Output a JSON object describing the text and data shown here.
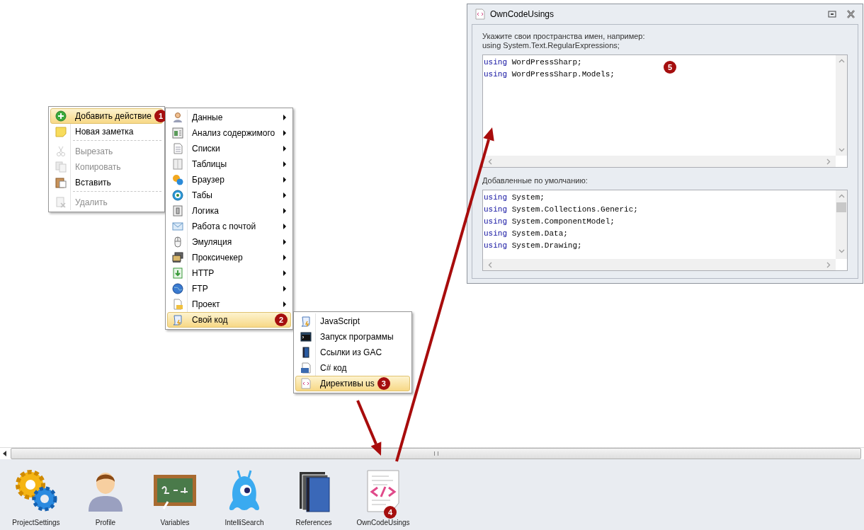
{
  "context_menu": {
    "items": [
      {
        "kind": "item",
        "label": "Добавить действие",
        "selected": true,
        "disabled": false,
        "badge": "1"
      },
      {
        "kind": "item",
        "label": "Новая заметка",
        "selected": false,
        "disabled": false
      },
      {
        "kind": "separator"
      },
      {
        "kind": "item",
        "label": "Вырезать",
        "selected": false,
        "disabled": true
      },
      {
        "kind": "item",
        "label": "Копировать",
        "selected": false,
        "disabled": true
      },
      {
        "kind": "item",
        "label": "Вставить",
        "selected": false,
        "disabled": false
      },
      {
        "kind": "separator"
      },
      {
        "kind": "item",
        "label": "Удалить",
        "selected": false,
        "disabled": true
      }
    ]
  },
  "actions_submenu": {
    "items": [
      {
        "kind": "item",
        "label": "Данные",
        "selected": false,
        "has_submenu": true
      },
      {
        "kind": "item",
        "label": "Анализ содержимого",
        "selected": false,
        "has_submenu": true
      },
      {
        "kind": "item",
        "label": "Списки",
        "selected": false,
        "has_submenu": true
      },
      {
        "kind": "item",
        "label": "Таблицы",
        "selected": false,
        "has_submenu": true
      },
      {
        "kind": "item",
        "label": "Браузер",
        "selected": false,
        "has_submenu": true
      },
      {
        "kind": "item",
        "label": "Табы",
        "selected": false,
        "has_submenu": true
      },
      {
        "kind": "item",
        "label": "Логика",
        "selected": false,
        "has_submenu": true
      },
      {
        "kind": "item",
        "label": "Работа с почтой",
        "selected": false,
        "has_submenu": true
      },
      {
        "kind": "item",
        "label": "Эмуляция",
        "selected": false,
        "has_submenu": true
      },
      {
        "kind": "item",
        "label": "Проксичекер",
        "selected": false,
        "has_submenu": true
      },
      {
        "kind": "item",
        "label": "HTTP",
        "selected": false,
        "has_submenu": true
      },
      {
        "kind": "item",
        "label": "FTP",
        "selected": false,
        "has_submenu": true
      },
      {
        "kind": "item",
        "label": "Проект",
        "selected": false,
        "has_submenu": true
      },
      {
        "kind": "item",
        "label": "Свой код",
        "selected": true,
        "has_submenu": false,
        "badge": "2"
      }
    ]
  },
  "code_submenu": {
    "items": [
      {
        "kind": "item",
        "label": "JavaScript",
        "selected": false
      },
      {
        "kind": "item",
        "label": "Запуск программы",
        "selected": false
      },
      {
        "kind": "item",
        "label": "Ссылки из GAC",
        "selected": false
      },
      {
        "kind": "item",
        "label": "C# код",
        "selected": false
      },
      {
        "kind": "item",
        "label": "Директивы us",
        "selected": true,
        "badge": "3"
      }
    ]
  },
  "window": {
    "title": "OwnCodeUsings",
    "hint_lines": [
      "Укажите свои пространства имен, например:",
      "using System.Text.RegularExpressions;"
    ],
    "custom_usings": [
      {
        "keyword": "using",
        "text": "WordPressSharp;"
      },
      {
        "keyword": "using",
        "text": "WordPressSharp.Models;"
      }
    ],
    "badge": "5",
    "default_label": "Добавленные по умолчанию:",
    "default_usings": [
      {
        "keyword": "using",
        "text": "System;"
      },
      {
        "keyword": "using",
        "text": "System.Collections.Generic;"
      },
      {
        "keyword": "using",
        "text": "System.ComponentModel;"
      },
      {
        "keyword": "using",
        "text": "System.Data;"
      },
      {
        "keyword": "using",
        "text": "System.Drawing;"
      }
    ]
  },
  "toolbar": {
    "items": [
      {
        "label": "ProjectSettings"
      },
      {
        "label": "Profile"
      },
      {
        "label": "Variables"
      },
      {
        "label": "IntelliSearch"
      },
      {
        "label": "References"
      },
      {
        "label": "OwnCodeUsings",
        "badge": "4"
      }
    ]
  }
}
